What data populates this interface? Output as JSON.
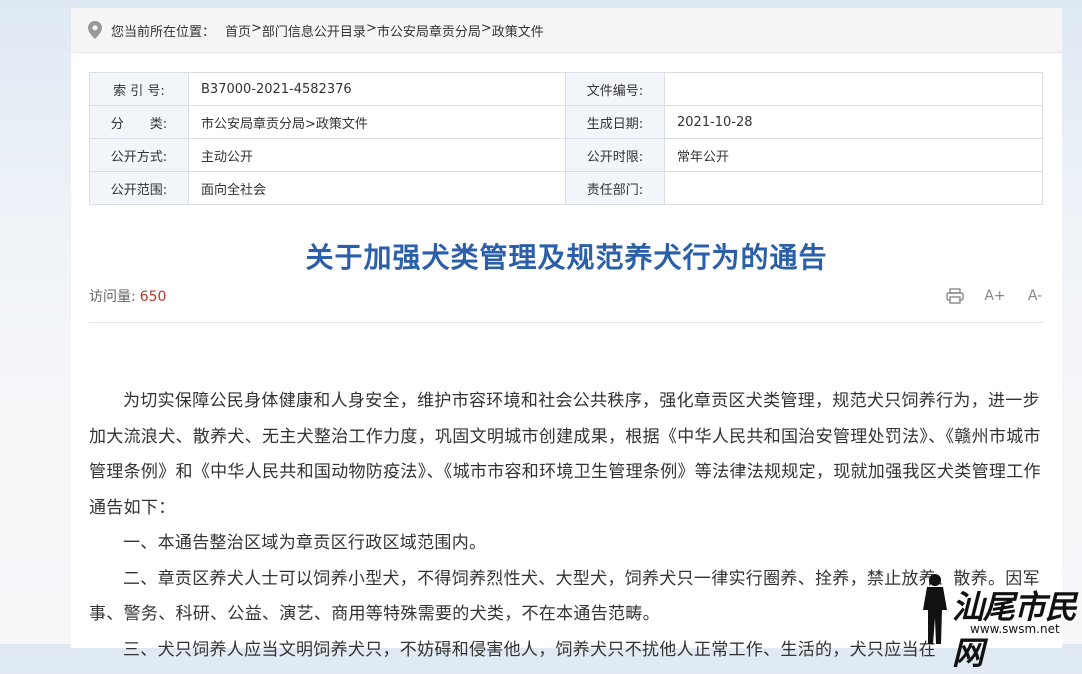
{
  "breadcrumb": {
    "label": "您当前所在位置：",
    "items": [
      "首页",
      "部门信息公开目录",
      "市公安局章贡分局",
      "政策文件"
    ],
    "separator": ">"
  },
  "meta": {
    "rows": [
      {
        "k1": "索 引 号:",
        "v1": "B37000-2021-4582376",
        "k2": "文件编号:",
        "v2": ""
      },
      {
        "k1": "分　　类:",
        "v1": "市公安局章贡分局>政策文件",
        "k2": "生成日期:",
        "v2": "2021-10-28"
      },
      {
        "k1": "公开方式:",
        "v1": "主动公开",
        "k2": "公开时限:",
        "v2": "常年公开"
      },
      {
        "k1": "公开范围:",
        "v1": "面向全社会",
        "k2": "责任部门:",
        "v2": ""
      }
    ]
  },
  "article": {
    "title": "关于加强犬类管理及规范养犬行为的通告",
    "visits_label": "访问量:",
    "visits_count": "650",
    "paragraphs": [
      "为切实保障公民身体健康和人身安全，维护市容环境和社会公共秩序，强化章贡区犬类管理，规范犬只饲养行为，进一步加大流浪犬、散养犬、无主犬整治工作力度，巩固文明城市创建成果，根据《中华人民共和国治安管理处罚法》、《赣州市城市管理条例》和《中华人民共和国动物防疫法》、《城市市容和环境卫生管理条例》等法律法规规定，现就加强我区犬类管理工作通告如下：",
      "一、本通告整治区域为章贡区行政区域范围内。",
      "二、章贡区养犬人士可以饲养小型犬，不得饲养烈性犬、大型犬，饲养犬只一律实行圈养、拴养，禁止放养、散养。因军事、警务、科研、公益、演艺、商用等特殊需要的犬类，不在本通告范畴。",
      "三、犬只饲养人应当文明饲养犬只，不妨碍和侵害他人，饲养犬只不扰他人正常工作、生活的，犬只应当在"
    ]
  },
  "tools": {
    "print": "print-icon",
    "font_up": "A+",
    "font_down": "A-"
  },
  "watermark": {
    "text": "汕尾市民网",
    "url": "www.swsm.net"
  }
}
